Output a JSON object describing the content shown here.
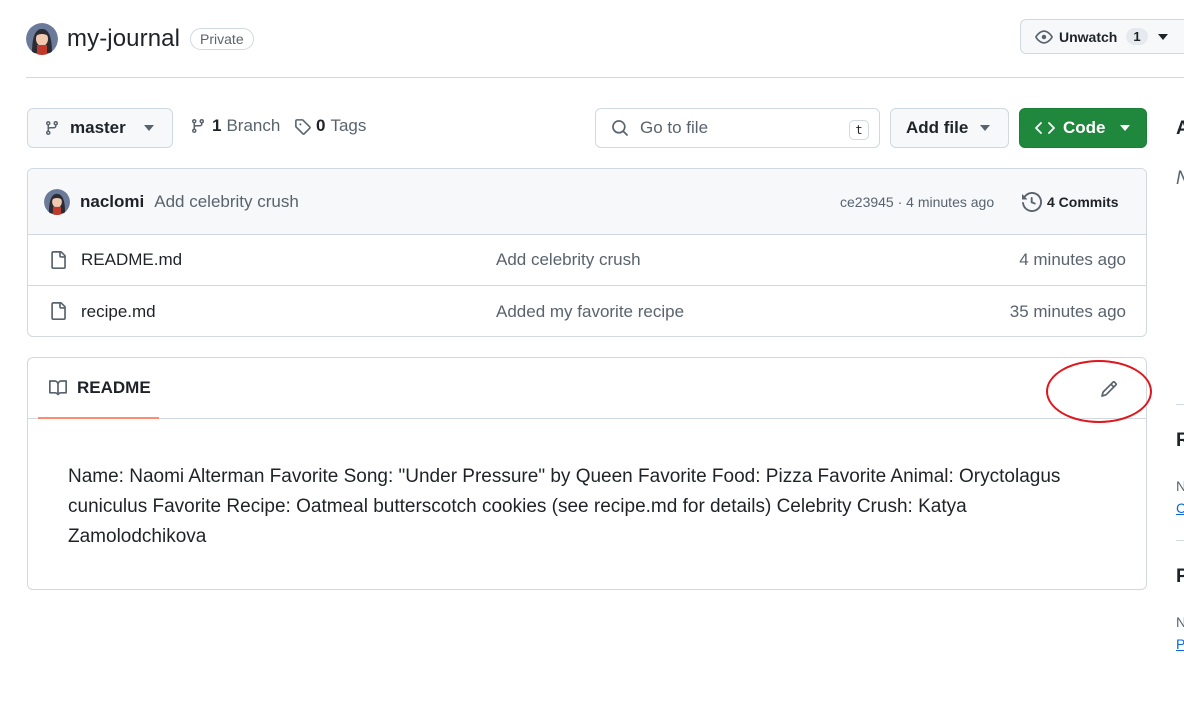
{
  "repo": {
    "name": "my-journal",
    "visibility": "Private"
  },
  "watch": {
    "label": "Unwatch",
    "count": "1"
  },
  "toolbar": {
    "branch": "master",
    "branches_count": "1",
    "branches_label": "Branch",
    "tags_count": "0",
    "tags_label": "Tags",
    "search_placeholder": "Go to file",
    "search_shortcut": "t",
    "add_file_label": "Add file",
    "code_label": "Code"
  },
  "latest_commit": {
    "author": "naclomi",
    "message": "Add celebrity crush",
    "meta": "ce23945 · 4 minutes ago",
    "commits_label": "4 Commits"
  },
  "files": [
    {
      "name": "README.md",
      "message": "Add celebrity crush",
      "date": "4 minutes ago"
    },
    {
      "name": "recipe.md",
      "message": "Added my favorite recipe",
      "date": "35 minutes ago"
    }
  ],
  "readme": {
    "tab_label": "README",
    "content": "Name: Naomi Alterman Favorite Song: \"Under Pressure\" by Queen Favorite Food: Pizza Favorite Animal: Oryctolagus cuniculus Favorite Recipe: Oatmeal butterscotch cookies (see recipe.md for details) Celebrity Crush: Katya Zamolodchikova"
  },
  "sidebar_fragments": {
    "heading_about": "A",
    "heading_releases": "R",
    "heading_packages": "P",
    "text_1": "N",
    "link_1": "C",
    "text_2": "N",
    "link_2": "P"
  },
  "colors": {
    "accent_green": "#1f883d",
    "tab_underline": "#fd8c73",
    "annotation_red": "#e0161d",
    "border": "#d1d9e0",
    "muted_text": "#59636e"
  },
  "icons": {
    "watch": "eye-icon",
    "branch": "git-branch-icon",
    "tags": "tag-icon",
    "search": "search-icon",
    "code": "code-icon",
    "history": "history-icon",
    "file": "file-icon",
    "readme": "book-icon",
    "edit": "pencil-icon"
  }
}
